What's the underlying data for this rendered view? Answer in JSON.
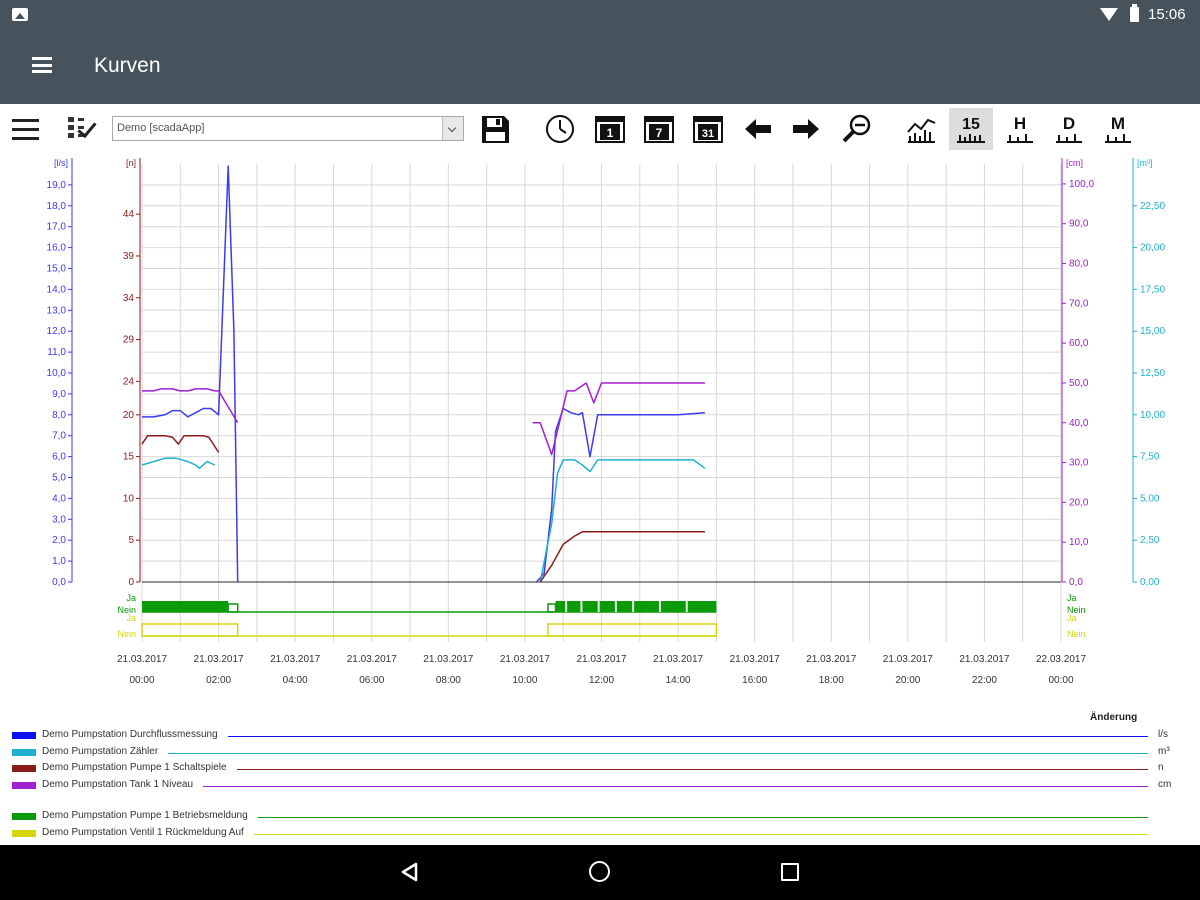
{
  "status_bar": {
    "time": "15:06",
    "icons": [
      "gallery-icon",
      "wifi-icon",
      "battery-icon"
    ]
  },
  "app_bar": {
    "title": "Kurven",
    "menu_icon": "hamburger-icon"
  },
  "toolbar": {
    "selected_project": "Demo [scadaApp]",
    "buttons": [
      {
        "name": "save-icon"
      },
      {
        "name": "clock-icon"
      },
      {
        "name": "calendar-1-icon",
        "text": "1"
      },
      {
        "name": "calendar-7-icon",
        "text": "7"
      },
      {
        "name": "calendar-31-icon",
        "text": "31"
      },
      {
        "name": "arrow-left-icon"
      },
      {
        "name": "arrow-right-icon"
      },
      {
        "name": "zoom-out-icon"
      },
      {
        "name": "chart-icon"
      },
      {
        "name": "interval-15-icon",
        "text": "15",
        "active": true
      },
      {
        "name": "interval-h-icon",
        "text": "H"
      },
      {
        "name": "interval-d-icon",
        "text": "D"
      },
      {
        "name": "interval-m-icon",
        "text": "M"
      }
    ]
  },
  "chart_data": {
    "type": "line",
    "x_ticks": [
      {
        "date": "21.03.2017",
        "time": "00:00"
      },
      {
        "date": "21.03.2017",
        "time": "02:00"
      },
      {
        "date": "21.03.2017",
        "time": "04:00"
      },
      {
        "date": "21.03.2017",
        "time": "06:00"
      },
      {
        "date": "21.03.2017",
        "time": "08:00"
      },
      {
        "date": "21.03.2017",
        "time": "10:00"
      },
      {
        "date": "21.03.2017",
        "time": "12:00"
      },
      {
        "date": "21.03.2017",
        "time": "14:00"
      },
      {
        "date": "21.03.2017",
        "time": "16:00"
      },
      {
        "date": "21.03.2017",
        "time": "18:00"
      },
      {
        "date": "21.03.2017",
        "time": "20:00"
      },
      {
        "date": "21.03.2017",
        "time": "22:00"
      },
      {
        "date": "22.03.2017",
        "time": "00:00"
      }
    ],
    "xlim_hours": [
      0,
      24
    ],
    "grid": true,
    "axes": [
      {
        "id": "flow",
        "label": "[l/s]",
        "color": "#3b3bf0",
        "side": "left",
        "range": [
          0,
          20
        ],
        "ticks": [
          "0,0",
          "1,0",
          "2,0",
          "3,0",
          "4,0",
          "5,0",
          "6,0",
          "7,0",
          "8,0",
          "9,0",
          "10,0",
          "11,0",
          "12,0",
          "13,0",
          "14,0",
          "15,0",
          "16,0",
          "17,0",
          "18,0",
          "19,0"
        ]
      },
      {
        "id": "count",
        "label": "[n]",
        "color": "#8b1a1a",
        "side": "left",
        "range": [
          0,
          50
        ],
        "ticks": [
          "0",
          "5",
          "10",
          "15",
          "20",
          "24",
          "29",
          "34",
          "39",
          "44"
        ]
      },
      {
        "id": "level",
        "label": "[cm]",
        "color": "#a020d0",
        "side": "right",
        "range": [
          0,
          105
        ],
        "ticks": [
          "0,0",
          "10,0",
          "20,0",
          "30,0",
          "40,0",
          "50,0",
          "60,0",
          "70,0",
          "80,0",
          "90,0",
          "100,0"
        ]
      },
      {
        "id": "volume",
        "label": "[m³]",
        "color": "#20b0d0",
        "side": "right",
        "range": [
          0,
          25
        ],
        "ticks": [
          "0,00",
          "2,50",
          "5,00",
          "7,50",
          "10,00",
          "12,50",
          "15,00",
          "17,50",
          "20,00",
          "22,50"
        ]
      }
    ],
    "series": [
      {
        "name": "Demo Pumpstation  Durchflussmessung",
        "unit": "l/s",
        "axis": "flow",
        "color": "#3b3bf0",
        "points": [
          [
            0,
            7.9
          ],
          [
            0.3,
            7.9
          ],
          [
            0.6,
            8.0
          ],
          [
            0.8,
            8.2
          ],
          [
            1.0,
            8.2
          ],
          [
            1.2,
            7.9
          ],
          [
            1.4,
            8.1
          ],
          [
            1.6,
            8.3
          ],
          [
            1.8,
            8.3
          ],
          [
            2.0,
            8.0
          ],
          [
            2.25,
            19.9
          ],
          [
            2.4,
            12
          ],
          [
            2.5,
            0
          ],
          [
            10.3,
            0
          ],
          [
            10.5,
            0.4
          ],
          [
            10.7,
            3.5
          ],
          [
            10.8,
            7.2
          ],
          [
            11.0,
            8.3
          ],
          [
            11.2,
            8.1
          ],
          [
            11.4,
            8.0
          ],
          [
            11.5,
            8.1
          ],
          [
            11.7,
            6.0
          ],
          [
            11.9,
            8.0
          ],
          [
            12.5,
            8.0
          ],
          [
            13.0,
            8.0
          ],
          [
            14.0,
            8.0
          ],
          [
            14.7,
            8.1
          ]
        ]
      },
      {
        "name": "Demo Pumpstation  Zähler",
        "unit": "m³",
        "axis": "volume",
        "color": "#20b0d0",
        "points": [
          [
            0,
            7.0
          ],
          [
            0.3,
            7.2
          ],
          [
            0.6,
            7.4
          ],
          [
            0.9,
            7.4
          ],
          [
            1.2,
            7.2
          ],
          [
            1.4,
            7.0
          ],
          [
            1.5,
            6.8
          ],
          [
            1.7,
            7.2
          ],
          [
            1.9,
            7.0
          ],
          [
            10.4,
            0
          ],
          [
            10.7,
            3.5
          ],
          [
            10.85,
            6.5
          ],
          [
            11.0,
            7.3
          ],
          [
            11.3,
            7.3
          ],
          [
            11.5,
            7.0
          ],
          [
            11.7,
            6.6
          ],
          [
            11.9,
            7.3
          ],
          [
            12.5,
            7.3
          ],
          [
            13.5,
            7.3
          ],
          [
            14.4,
            7.3
          ],
          [
            14.7,
            6.8
          ]
        ]
      },
      {
        "name": "Demo Pumpstation  Pumpe 1 Schaltspiele",
        "unit": "n",
        "axis": "count",
        "color": "#8b1a1a",
        "points": [
          [
            0,
            16.5
          ],
          [
            0.15,
            17.5
          ],
          [
            0.3,
            17.5
          ],
          [
            0.6,
            17.5
          ],
          [
            0.8,
            17.3
          ],
          [
            0.95,
            16.5
          ],
          [
            1.1,
            17.5
          ],
          [
            1.6,
            17.5
          ],
          [
            1.75,
            17.3
          ],
          [
            2.0,
            15.5
          ],
          [
            10.4,
            0
          ],
          [
            10.7,
            2.0
          ],
          [
            11.0,
            4.5
          ],
          [
            11.3,
            5.5
          ],
          [
            11.5,
            6.0
          ],
          [
            12.5,
            6.0
          ],
          [
            14.7,
            6.0
          ]
        ]
      },
      {
        "name": "Demo Pumpstation  Tank 1 Niveau",
        "unit": "cm",
        "axis": "level",
        "color": "#a020d0",
        "points": [
          [
            0,
            48
          ],
          [
            0.3,
            48
          ],
          [
            0.5,
            48.5
          ],
          [
            0.8,
            48.5
          ],
          [
            1.0,
            48
          ],
          [
            1.2,
            48
          ],
          [
            1.4,
            48.5
          ],
          [
            1.7,
            48.5
          ],
          [
            1.9,
            48
          ],
          [
            2.0,
            48
          ],
          [
            2.5,
            40
          ],
          [
            10.2,
            40
          ],
          [
            10.4,
            40
          ],
          [
            10.7,
            32
          ],
          [
            10.9,
            40
          ],
          [
            11.1,
            48
          ],
          [
            11.3,
            48
          ],
          [
            11.6,
            50
          ],
          [
            11.8,
            45
          ],
          [
            12.0,
            50
          ],
          [
            13.5,
            50
          ],
          [
            14.7,
            50
          ]
        ]
      }
    ],
    "digital": [
      {
        "name": "Demo Pumpstation  Pumpe 1 Betriebsmeldung",
        "color": "#0a9a0a",
        "yes_label": "Ja",
        "no_label": "Nein",
        "dense_ranges": [
          [
            0,
            2.25
          ],
          [
            10.8,
            15
          ]
        ],
        "yes_ranges": [
          [
            2.25,
            2.5
          ],
          [
            10.6,
            10.8
          ]
        ]
      },
      {
        "name": "Demo Pumpstation  Ventil 1 Rückmeldung Auf",
        "color": "#d6d610",
        "yes_label": "Ja",
        "no_label": "Nein",
        "yes_ranges": [
          [
            0,
            2.5
          ],
          [
            10.6,
            15
          ]
        ]
      }
    ]
  },
  "legend": {
    "header": "Änderung",
    "analog": [
      {
        "label": "Demo Pumpstation  Durchflussmessung",
        "color": "#1010ee",
        "unit": "l/s"
      },
      {
        "label": "Demo Pumpstation  Zähler",
        "color": "#20b0d0",
        "unit": "m³"
      },
      {
        "label": "Demo Pumpstation  Pumpe 1 Schaltspiele",
        "color": "#8b1a1a",
        "unit": "n"
      },
      {
        "label": "Demo Pumpstation  Tank 1 Niveau",
        "color": "#a020d0",
        "unit": "cm"
      }
    ],
    "digital": [
      {
        "label": "Demo Pumpstation  Pumpe 1 Betriebsmeldung",
        "color": "#0a9a0a"
      },
      {
        "label": "Demo Pumpstation  Ventil 1 Rückmeldung Auf",
        "color": "#d6d610"
      }
    ]
  },
  "nav_bar": {
    "buttons": [
      "back-icon",
      "home-icon",
      "recents-icon"
    ]
  }
}
